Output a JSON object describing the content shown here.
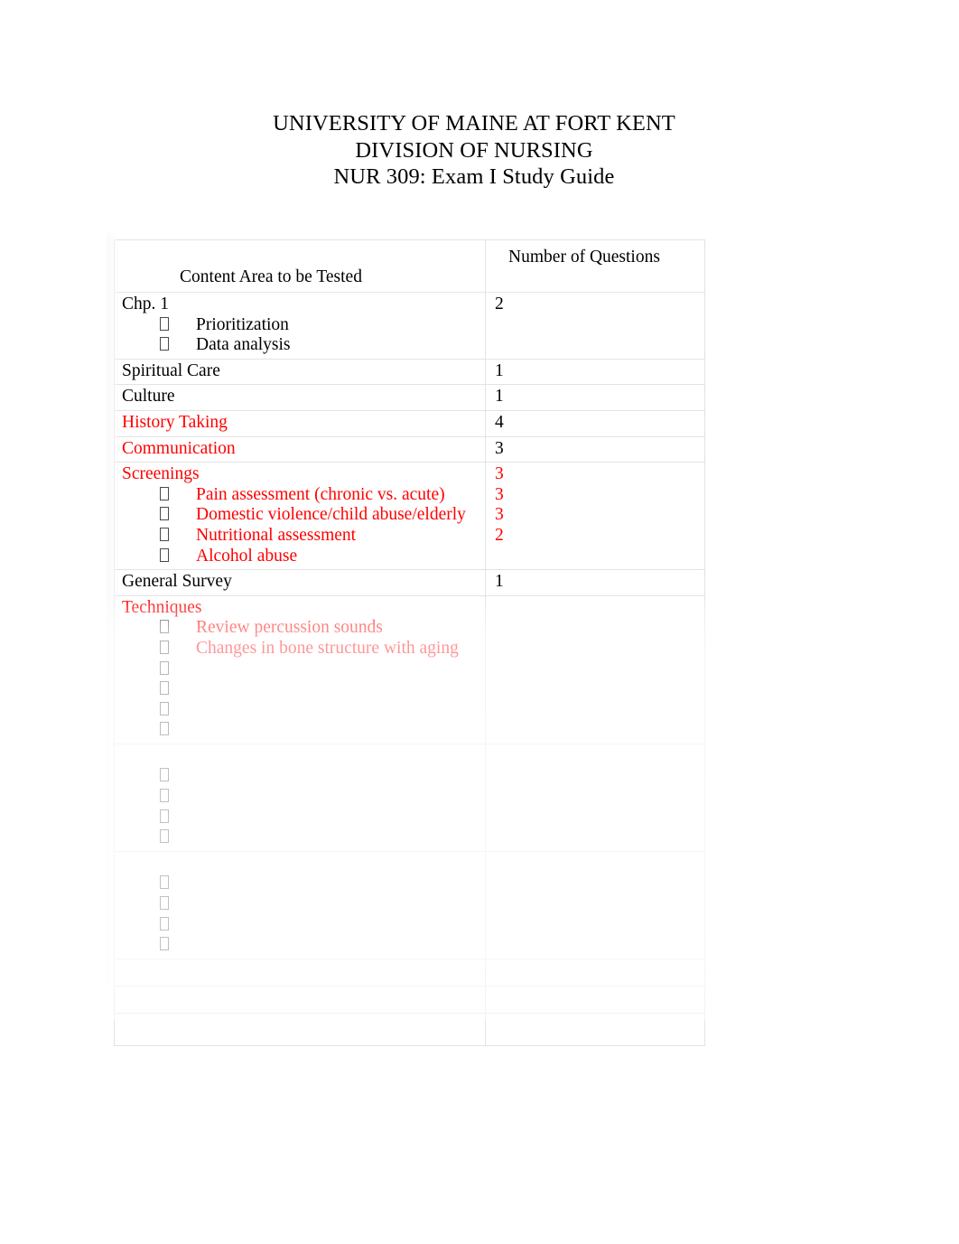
{
  "document": {
    "heading_lines": [
      "UNIVERSITY OF MAINE AT FORT KENT",
      "DIVISION OF NURSING",
      "NUR 309: Exam I Study Guide"
    ]
  },
  "table": {
    "headers": {
      "content_area": "Content Area to be Tested",
      "number_of_questions": "Number of Questions"
    },
    "colors": {
      "red": "#ff0000",
      "black": "#000000",
      "border": "#e3e3e3"
    },
    "rows": [
      {
        "title": "Chp. 1",
        "title_color": "black",
        "count": "2",
        "count_color": "black",
        "sub_items": [
          {
            "label": "Prioritization",
            "color": "black",
            "count": ""
          },
          {
            "label": "Data analysis",
            "color": "black",
            "count": ""
          }
        ]
      },
      {
        "title": "Spiritual Care",
        "title_color": "black",
        "count": "1",
        "count_color": "black",
        "sub_items": []
      },
      {
        "title": "Culture",
        "title_color": "black",
        "count": "1",
        "count_color": "black",
        "sub_items": []
      },
      {
        "title": "History Taking",
        "title_color": "red",
        "count": "4",
        "count_color": "black",
        "sub_items": []
      },
      {
        "title": "Communication",
        "title_color": "red",
        "count": "3",
        "count_color": "black",
        "sub_items": []
      },
      {
        "title": "Screenings",
        "title_color": "red",
        "count": "",
        "count_color": "red",
        "sub_items": [
          {
            "label": "Pain assessment (chronic vs. acute)",
            "color": "red",
            "count": "3"
          },
          {
            "label": "Domestic violence/child abuse/elderly",
            "color": "red",
            "count": "3"
          },
          {
            "label": "Nutritional assessment",
            "color": "red",
            "count": "3"
          },
          {
            "label": "Alcohol abuse",
            "color": "red",
            "count": "2"
          }
        ]
      },
      {
        "title": "General Survey",
        "title_color": "black",
        "count": "1",
        "count_color": "black",
        "sub_items": []
      },
      {
        "title": "Techniques",
        "title_color": "red",
        "count": "",
        "count_color": "red",
        "sub_items": [
          {
            "label": "Review percussion sounds",
            "color": "red",
            "count": ""
          },
          {
            "label": "Changes in bone structure with aging",
            "color": "red",
            "count": ""
          }
        ]
      }
    ]
  }
}
